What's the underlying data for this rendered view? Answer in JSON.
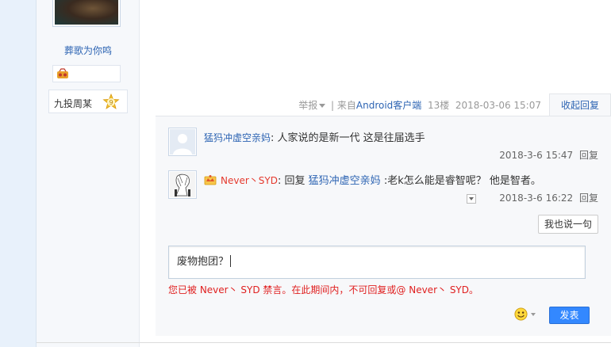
{
  "poster": {
    "username": "葬歌为你鸣",
    "rank_label": "九投周某",
    "rank_level": "9"
  },
  "post_meta": {
    "report": "举报",
    "source_prefix": "| 来自",
    "source_device": "Android客户端",
    "floor": "13楼",
    "datetime": "2018-03-06 15:07",
    "collapse_reply": "收起回复"
  },
  "replies": [
    {
      "username": "猛犸冲虚空亲妈",
      "separator": ":",
      "content": "人家说的是新一代 这是往届选手",
      "time": "2018-3-6 15:47",
      "reply_label": "回复"
    },
    {
      "username": "Never丶SYD",
      "separator": ":",
      "reply_word": "回复",
      "reply_to": "猛犸冲虚空亲妈",
      "content": ":老k怎么能是睿智呢？ 他是智者。",
      "time": "2018-3-6 16:22",
      "reply_label": "回复"
    }
  ],
  "composer": {
    "say_button": "我也说一句",
    "input_value": "废物抱团？",
    "banned_notice": "您已被 Never丶 SYD 禁言。在此期间内，不可回复或@ Never丶 SYD。",
    "submit_button": "发表",
    "emoji_icon": "smiley-icon"
  },
  "colors": {
    "link_blue": "#2d64b3",
    "warning_red": "#e02020",
    "submit_blue": "#3388ff"
  }
}
